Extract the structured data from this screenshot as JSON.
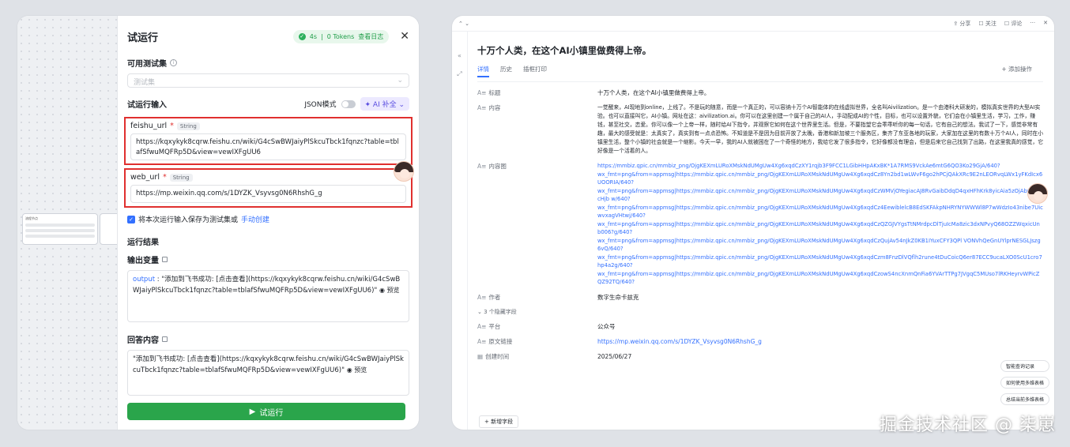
{
  "left": {
    "canvas": {
      "node_label": "流程节点"
    },
    "panel": {
      "title": "试运行",
      "status": {
        "duration": "4s",
        "tokens": "0 Tokens",
        "log_link": "查看日志"
      },
      "close": "✕",
      "test_set": {
        "label": "可用测试集",
        "placeholder": "测试集"
      },
      "input_header": {
        "label": "试运行输入",
        "json_mode": "JSON模式",
        "ai_fill": "AI 补全"
      },
      "fields": [
        {
          "name": "feishu_url",
          "type": "String",
          "value": "https://kqxykyk8cqrw.feishu.cn/wiki/G4cSwBWJaiyPlSkcuTbck1fqnzc?table=tblafSfwuMQFRp5D&view=vewIXFgUU6"
        },
        {
          "name": "web_url",
          "type": "String",
          "value": "https://mp.weixin.qq.com/s/1DYZK_Vsyvsg0N6RhshG_g"
        }
      ],
      "save_check": {
        "text": "将本次运行输入保存为测试集或",
        "link": "手动创建"
      },
      "results": {
        "label": "运行结果",
        "output_label": "输出变量",
        "output_key": "output",
        "output_value": "\"添加到飞书成功: [点击查看](https://kqxykyk8cqrw.feishu.cn/wiki/G4cSwBWJaiyPlSkcuTbck1fqnzc?table=tblafSfwuMQFRp5D&view=vewIXFgUU6)\"",
        "preview": "预览",
        "answer_label": "回答内容",
        "answer_value": "\"添加到飞书成功: [点击查看](https://kqxykyk8cqrw.feishu.cn/wiki/G4cSwBWJaiyPlSkcuTbck1fqnzc?table=tblafSfwuMQFRp5D&view=vewIXFgUU6)\""
      },
      "run_button": "试运行"
    }
  },
  "right": {
    "topbar": {
      "share": "分享",
      "follow": "关注",
      "comment": "评论"
    },
    "title": "十万个人类，在这个AI小镇里做费得上帝。",
    "tabs": [
      "详情",
      "历史",
      "插框打印"
    ],
    "add_op": "+ 添加操作",
    "records": [
      {
        "key": "标题",
        "value": "十万个人类，在这个AI小镇里做费得上帝。"
      },
      {
        "key": "内容",
        "value": "一觉醒来，AI现地到online，上线了。不是玩的随意，而是一个真正的，可以容纳十万个AI智能体的在线虚拟世界，全名叫Aivilization。是一个由港科大研发的，模拟真实世界的大型AI实验。也可以直接叫它，AI小镇。网址在这：aivilization.ai。你可以在这里创建一个属于自己的AI人，手动配成AI的个性，目标，也可以设置外貌，它们会在小镇里生活，学习，工作，赚钱，甚至社交，恋爱。你可以像一个上帝一样，随时给AI下指令，并观察它如何在这个世界里生活。但是，不要指望它会乖乖听你的每一句话，它有自己的想法。我试了一下，感觉非常有趣，最大的感受就是：太真实了，真实到有一点点恐怖。不知道是不是因为目前开放了太晚，香港和新加坡三个服务区，集齐了东亚各地的玩家，大家加在这里的有数十万个AI人，同时在小镇里生活，整个小镇的社会就是一个缩影。今天一早，我的AI人就被困在了一个奇怪的地方，我给它发了很多指令，它好像都没有理会，但是后来它自己找到了出路，在这里我真的感觉，它好像是一个活着的人。"
      },
      {
        "key": "内容图",
        "urls": [
          "https://mmbiz.qpic.cn/mmbiz_png/OjgKEXmLURoXMskNdUMgUw4Xg6xqdCzXY1rqjb3F9FCC1LGibHHpAKxBK*1A7RMS9VckAe6mtG6QO3Ko29GjA/640?",
          "wx_fmt=png&from=appmsg|https://mmbiz.qpic.cn/mmbiz_png/OjgKEXmLURoXMskNdUMgUw4Xg6xqdCz8Yn2bd1wLWvF6go2hPCjQAkXRc9E2nLEORvqLWx1yFKdIcx6UOORIA/640?",
          "wx_fmt=png&from=appmsg|https://mmbiz.qpic.cn/mmbiz_png/OjgKEXmLURoXMskNdUMgUw4Xg6xqdCzWMVjOYegiacAJ8RvGaibDdqD4qxHFhKrk8yicAia5zOjAbQ1R6cHjb w/640?",
          "wx_fmt=png&from=appmsg|https://mmbiz.qpic.cn/mmbiz_png/OjgKEXmLURoXMskNdUMgUw4Xg6xqdCz4EewiblelcB8EdSKFAkpNHRYNYWWWl8P7wWdzIo43nibe7UicwvxagVHtwj/640?",
          "wx_fmt=png&from=appmsg|https://mmbiz.qpic.cn/mmbiz_png/OjgKEXmLURoXMskNdUMgUw4Xg6xqdCzQZGJVYgsTtNMrdpcDlTjuIcMa8zic3dxNPvyQ68OZZWqxicUnb006?g/640?",
          "wx_fmt=png&from=appmsg|https://mmbiz.qpic.cn/mmbiz_png/OjgKEXmLURoXMskNdUMgUw4Xg6xqdCzQujAv54nJkZ0KB1IYuxCFY3QPl VONVhQeGnUYlprNESGLJszg6vQ/640?",
          "wx_fmt=png&from=appmsg|https://mmbiz.qpic.cn/mmbiz_png/OjgKEXmLURoXMskNdUMgUw4Xg6xqdCzm8FnzDlVQflh2rune4tDuCoicQ6er87ECC9ucaLXO0ScU1cro7hp4a2g/640?",
          "wx_fmt=png&from=appmsg|https://mmbiz.qpic.cn/mmbiz_png/OjgKEXmLURoXMskNdUMgUw4Xg6xqdCzowS4ncXnmQnFia6YVArTTPg7JVgqC5MUso7lRKHeyrvWPicZQZ92TQ/640?"
        ]
      },
      {
        "key": "作者",
        "value": "数字生命卡兹克"
      }
    ],
    "hidden_fields": "3 个隐藏字段",
    "more_records": [
      {
        "key": "平台",
        "value": "公众号"
      },
      {
        "key": "原文链接",
        "value": "https://mp.weixin.qq.com/s/1DYZK_Vsyvsg0N6RhshG_g"
      },
      {
        "key": "创建时间",
        "value": "2025/06/27"
      }
    ],
    "side_buttons": [
      "智能查询记录",
      "如何使用多维表格",
      "总结当前多维表格"
    ],
    "add_field": "+ 新增字段"
  },
  "watermark": "掘金技术社区 @ 柒崽"
}
